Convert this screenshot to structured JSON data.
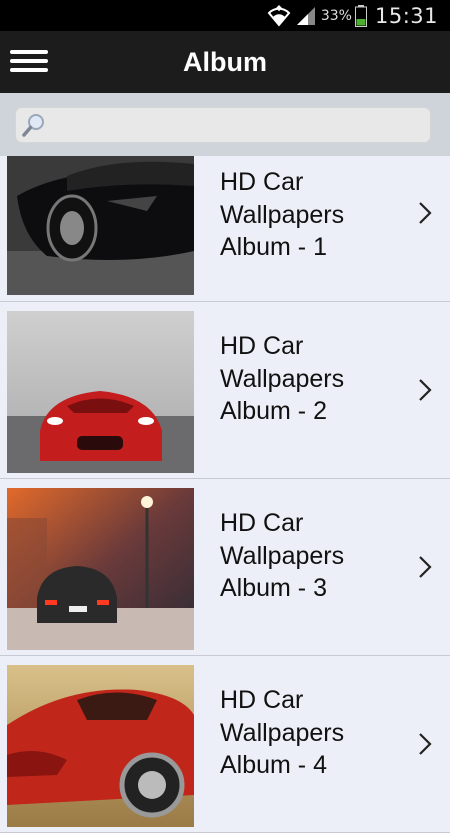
{
  "status_bar": {
    "battery_percent": "33%",
    "time": "15:31",
    "icons": [
      "wifi-icon",
      "signal-icon",
      "battery-icon"
    ]
  },
  "app_bar": {
    "title": "Album",
    "menu_icon": "hamburger-menu-icon"
  },
  "search": {
    "placeholder": "",
    "value": "",
    "icon": "search-icon"
  },
  "albums": [
    {
      "title": "HD Car\nWallpapers\nAlbum  - 1",
      "thumbnail": "black sports car front",
      "chevron_icon": "chevron-right-icon"
    },
    {
      "title": "HD Car\nWallpapers\nAlbum  - 2",
      "thumbnail": "red sports car front",
      "chevron_icon": "chevron-right-icon"
    },
    {
      "title": "HD Car\nWallpapers\nAlbum  - 3",
      "thumbnail": "car rear on night street",
      "chevron_icon": "chevron-right-icon"
    },
    {
      "title": "HD Car\nWallpapers\nAlbum  - 4",
      "thumbnail": "red supercar side",
      "chevron_icon": "chevron-right-icon"
    }
  ],
  "colors": {
    "status_bar": "#000000",
    "app_bar": "#1c1c1c",
    "search_area": "#cfd3da",
    "list_background": "#eceff7",
    "divider": "#c7cad3"
  }
}
